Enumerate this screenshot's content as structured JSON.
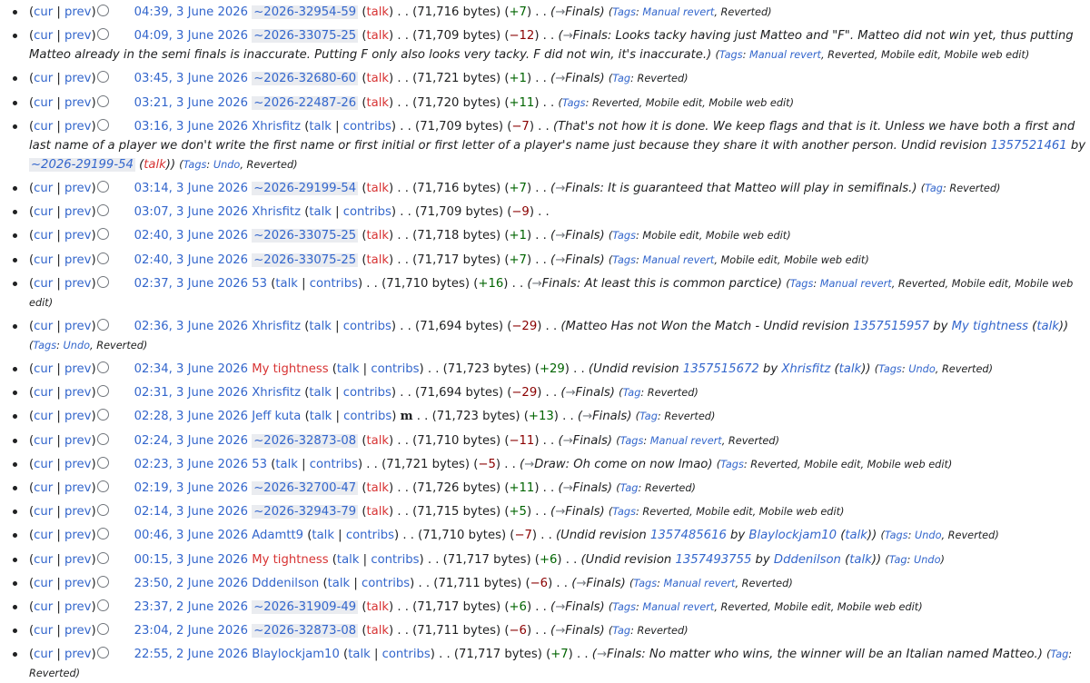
{
  "labels": {
    "cur": "cur",
    "prev": "prev",
    "talk": "talk",
    "contribs": "contribs",
    "bytes": "bytes",
    "tag": "Tag",
    "tags": "Tags"
  },
  "revisions": [
    {
      "date": "04:39, 3 June 2026",
      "user": "~2026-32954-59",
      "utype": "temp",
      "size": "71,716",
      "diff": "+7",
      "section": "Finals",
      "summary": "",
      "tags": [
        "Manual revert",
        "Reverted"
      ]
    },
    {
      "date": "04:09, 3 June 2026",
      "user": "~2026-33075-25",
      "utype": "temp",
      "size": "71,709",
      "diff": "−12",
      "section": "Finals",
      "summary": "Looks tacky having just Matteo and \"F\". Matteo did not win yet, thus putting Matteo already in the semi finals is inaccurate. Putting F only also looks very tacky. F did not win, it's inaccurate.",
      "tags": [
        "Manual revert",
        "Reverted",
        "Mobile edit",
        "Mobile web edit"
      ]
    },
    {
      "date": "03:45, 3 June 2026",
      "user": "~2026-32680-60",
      "utype": "temp",
      "size": "71,721",
      "diff": "+1",
      "section": "Finals",
      "summary": "",
      "tags": [
        "Reverted"
      ]
    },
    {
      "date": "03:21, 3 June 2026",
      "user": "~2026-22487-26",
      "utype": "temp",
      "size": "71,720",
      "diff": "+11",
      "section": "",
      "summary": "",
      "tags": [
        "Reverted",
        "Mobile edit",
        "Mobile web edit"
      ]
    },
    {
      "date": "03:16, 3 June 2026",
      "user": "Xhrisfitz",
      "utype": "reg",
      "size": "71,709",
      "diff": "−7",
      "section": "",
      "summary": "That's not how it is done. We keep flags and that is it. Unless we have both a first and last name of a player we don't write the first name or first initial or first letter of a player's name just because they share it with another person. Undid revision",
      "undo_rev": "1357521461",
      "undo_user": "~2026-29199-54",
      "undo_utype": "temp",
      "tags": [
        "Undo",
        "Reverted"
      ]
    },
    {
      "date": "03:14, 3 June 2026",
      "user": "~2026-29199-54",
      "utype": "temp",
      "size": "71,716",
      "diff": "+7",
      "section": "Finals",
      "summary": "It is guaranteed that Matteo will play in semifinals.",
      "tags": [
        "Reverted"
      ]
    },
    {
      "date": "03:07, 3 June 2026",
      "user": "Xhrisfitz",
      "utype": "reg",
      "size": "71,709",
      "diff": "−9",
      "section": "",
      "summary": "",
      "tags": []
    },
    {
      "date": "02:40, 3 June 2026",
      "user": "~2026-33075-25",
      "utype": "temp",
      "size": "71,718",
      "diff": "+1",
      "section": "Finals",
      "summary": "",
      "tags": [
        "Mobile edit",
        "Mobile web edit"
      ]
    },
    {
      "date": "02:40, 3 June 2026",
      "user": "~2026-33075-25",
      "utype": "temp",
      "size": "71,717",
      "diff": "+7",
      "section": "Finals",
      "summary": "",
      "tags": [
        "Manual revert",
        "Mobile edit",
        "Mobile web edit"
      ]
    },
    {
      "date": "02:37, 3 June 2026",
      "user": "53",
      "utype": "reg",
      "size": "71,710",
      "diff": "+16",
      "section": "Finals",
      "summary": "At least this is common parctice",
      "tags": [
        "Manual revert",
        "Reverted",
        "Mobile edit",
        "Mobile web edit"
      ]
    },
    {
      "date": "02:36, 3 June 2026",
      "user": "Xhrisfitz",
      "utype": "reg",
      "size": "71,694",
      "diff": "−29",
      "section": "",
      "summary": "Matteo Has not Won the Match - Undid revision",
      "undo_rev": "1357515957",
      "undo_user": "My tightness",
      "undo_utype": "reg",
      "tags": [
        "Undo",
        "Reverted"
      ]
    },
    {
      "date": "02:34, 3 June 2026",
      "user": "My tightness",
      "utype": "red",
      "size": "71,723",
      "diff": "+29",
      "section": "",
      "summary": "Undid revision",
      "undo_rev": "1357515672",
      "undo_user": "Xhrisfitz",
      "undo_utype": "reg",
      "tags": [
        "Undo",
        "Reverted"
      ]
    },
    {
      "date": "02:31, 3 June 2026",
      "user": "Xhrisfitz",
      "utype": "reg",
      "size": "71,694",
      "diff": "−29",
      "section": "Finals",
      "summary": "",
      "tags": [
        "Reverted"
      ]
    },
    {
      "date": "02:28, 3 June 2026",
      "user": "Jeff kuta",
      "utype": "reg",
      "minor": "m",
      "size": "71,723",
      "diff": "+13",
      "section": "Finals",
      "summary": "",
      "tags": [
        "Reverted"
      ]
    },
    {
      "date": "02:24, 3 June 2026",
      "user": "~2026-32873-08",
      "utype": "temp",
      "size": "71,710",
      "diff": "−11",
      "section": "Finals",
      "summary": "",
      "tags": [
        "Manual revert",
        "Reverted"
      ]
    },
    {
      "date": "02:23, 3 June 2026",
      "user": "53",
      "utype": "reg",
      "size": "71,721",
      "diff": "−5",
      "section": "Draw",
      "summary": "Oh come on now lmao",
      "tags": [
        "Reverted",
        "Mobile edit",
        "Mobile web edit"
      ]
    },
    {
      "date": "02:19, 3 June 2026",
      "user": "~2026-32700-47",
      "utype": "temp",
      "size": "71,726",
      "diff": "+11",
      "section": "Finals",
      "summary": "",
      "tags": [
        "Reverted"
      ]
    },
    {
      "date": "02:14, 3 June 2026",
      "user": "~2026-32943-79",
      "utype": "temp",
      "size": "71,715",
      "diff": "+5",
      "section": "Finals",
      "summary": "",
      "tags": [
        "Reverted",
        "Mobile edit",
        "Mobile web edit"
      ]
    },
    {
      "date": "00:46, 3 June 2026",
      "user": "Adamtt9",
      "utype": "reg",
      "size": "71,710",
      "diff": "−7",
      "section": "",
      "summary": "Undid revision",
      "undo_rev": "1357485616",
      "undo_user": "Blaylockjam10",
      "undo_utype": "reg",
      "tags": [
        "Undo",
        "Reverted"
      ]
    },
    {
      "date": "00:15, 3 June 2026",
      "user": "My tightness",
      "utype": "red",
      "size": "71,717",
      "diff": "+6",
      "section": "",
      "summary": "Undid revision",
      "undo_rev": "1357493755",
      "undo_user": "Dddenilson",
      "undo_utype": "reg",
      "tags": [
        "Undo"
      ]
    },
    {
      "date": "23:50, 2 June 2026",
      "user": "Dddenilson",
      "utype": "reg",
      "size": "71,711",
      "diff": "−6",
      "section": "Finals",
      "summary": "",
      "tags": [
        "Manual revert",
        "Reverted"
      ]
    },
    {
      "date": "23:37, 2 June 2026",
      "user": "~2026-31909-49",
      "utype": "temp",
      "size": "71,717",
      "diff": "+6",
      "section": "Finals",
      "summary": "",
      "tags": [
        "Manual revert",
        "Reverted",
        "Mobile edit",
        "Mobile web edit"
      ]
    },
    {
      "date": "23:04, 2 June 2026",
      "user": "~2026-32873-08",
      "utype": "temp",
      "size": "71,711",
      "diff": "−6",
      "section": "Finals",
      "summary": "",
      "tags": [
        "Reverted"
      ]
    },
    {
      "date": "22:55, 2 June 2026",
      "user": "Blaylockjam10",
      "utype": "reg",
      "size": "71,717",
      "diff": "+7",
      "section": "Finals",
      "summary": "No matter who wins, the winner will be an Italian named Matteo.",
      "tags": [
        "Reverted"
      ]
    }
  ]
}
